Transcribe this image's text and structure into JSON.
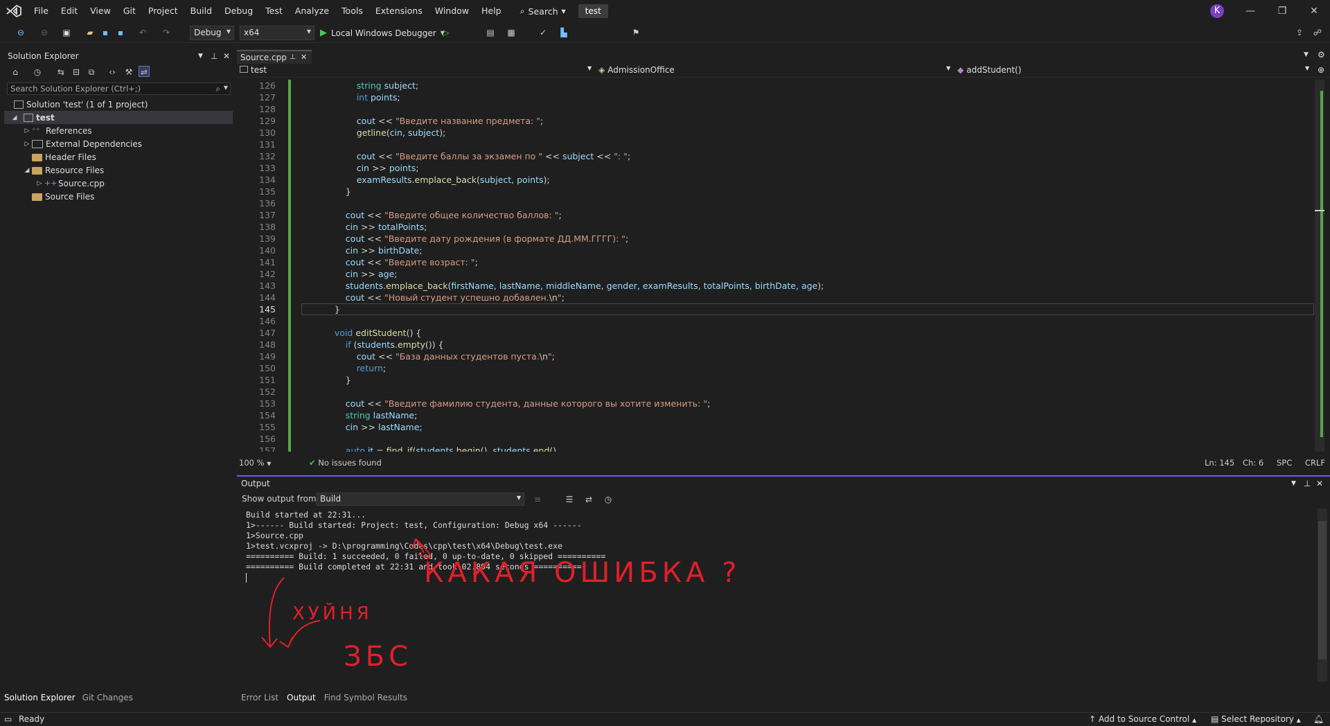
{
  "menubar": {
    "items": [
      "File",
      "Edit",
      "View",
      "Git",
      "Project",
      "Build",
      "Debug",
      "Test",
      "Analyze",
      "Tools",
      "Extensions",
      "Window",
      "Help"
    ],
    "search_label": "Search",
    "solution_badge": "test",
    "avatar_initial": "K"
  },
  "toolbar": {
    "config": "Debug",
    "platform": "x64",
    "debugger": "Local Windows Debugger"
  },
  "solution_explorer": {
    "title": "Solution Explorer",
    "search_placeholder": "Search Solution Explorer (Ctrl+;)",
    "tree": {
      "solution": "Solution 'test' (1 of 1 project)",
      "project": "test",
      "references": "References",
      "external_deps": "External Dependencies",
      "header_files": "Header Files",
      "resource_files": "Resource Files",
      "source_cpp": "Source.cpp",
      "source_files": "Source Files"
    },
    "tabs": [
      "Solution Explorer",
      "Git Changes"
    ]
  },
  "editor": {
    "tab_label": "Source.cpp",
    "nav": {
      "project": "test",
      "class": "AdmissionOffice",
      "member": "addStudent()"
    },
    "line_numbers": [
      "126",
      "127",
      "128",
      "129",
      "130",
      "131",
      "132",
      "133",
      "134",
      "135",
      "136",
      "137",
      "138",
      "139",
      "140",
      "141",
      "142",
      "143",
      "144",
      "145",
      "146",
      "147",
      "148",
      "149",
      "150",
      "151",
      "152",
      "153",
      "154",
      "155",
      "156",
      "157"
    ],
    "active_line": "145",
    "status": {
      "zoom": "100 %",
      "issues": "No issues found",
      "ln": "Ln: 145",
      "ch": "Ch: 6",
      "spc": "SPC",
      "crlf": "CRLF"
    }
  },
  "output": {
    "title": "Output",
    "show_from_label": "Show output from:",
    "source": "Build",
    "lines": [
      "Build started at 22:31...",
      "1>------ Build started: Project: test, Configuration: Debug x64 ------",
      "1>Source.cpp",
      "1>test.vcxproj -> D:\\programming\\Codes\\cpp\\test\\x64\\Debug\\test.exe",
      "========== Build: 1 succeeded, 0 failed, 0 up-to-date, 0 skipped ==========",
      "========== Build completed at 22:31 and took 02.894 seconds =========="
    ],
    "tabs": [
      "Error List",
      "Output",
      "Find Symbol Results"
    ]
  },
  "annotations": {
    "question": "КАКАЯ ОШИБКА ?",
    "word1": "ХУЙНЯ",
    "word2": "ЗБС",
    "color": "#e0202a"
  },
  "statusbar": {
    "ready": "Ready",
    "source_control": "Add to Source Control",
    "repository": "Select Repository"
  }
}
